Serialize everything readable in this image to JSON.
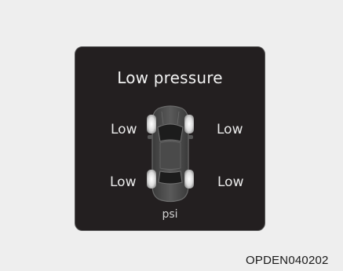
{
  "display": {
    "title": "Low pressure",
    "tires": {
      "front_left": "Low",
      "front_right": "Low",
      "rear_left": "Low",
      "rear_right": "Low"
    },
    "unit": "psi"
  },
  "figure_code": "OPDEN040202",
  "icon": "car-top-view-icon",
  "colors": {
    "page_background": "#eeeeee",
    "panel_background": "#231f20",
    "tire_highlight": "#e8e8e8",
    "text": "#f2f2f2"
  }
}
